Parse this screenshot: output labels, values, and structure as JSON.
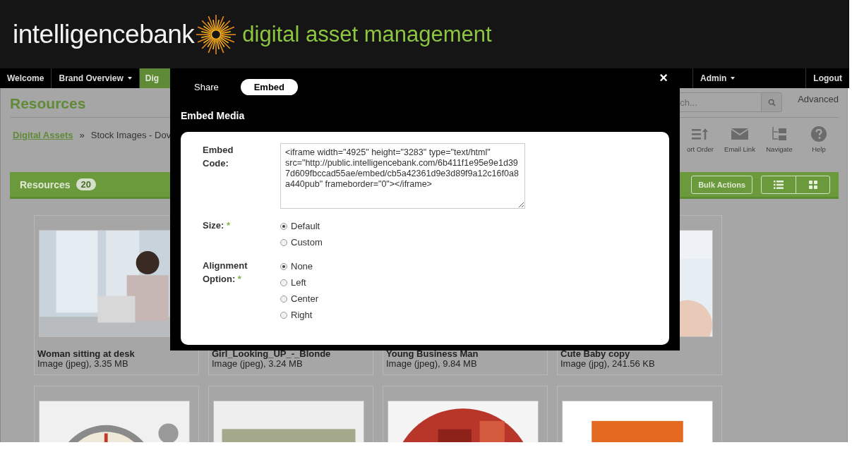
{
  "header": {
    "logo_text": "intelligencebank",
    "tagline": "digital asset management"
  },
  "nav": {
    "left": [
      {
        "label": "Welcome",
        "dropdown": false,
        "selected": false
      },
      {
        "label": "Brand Overview",
        "dropdown": true,
        "selected": false
      },
      {
        "label": "Dig",
        "dropdown": false,
        "selected": true
      }
    ],
    "right": [
      {
        "label": "Admin",
        "dropdown": true,
        "selected": false
      },
      {
        "label": "Logout",
        "dropdown": false,
        "selected": false
      }
    ]
  },
  "page": {
    "title": "Resources",
    "search": {
      "placeholder": "ch..."
    },
    "advanced": "Advanced",
    "breadcrumb": [
      {
        "label": "Digital Assets",
        "kind": "link"
      },
      {
        "label": "Stock Images - Dov",
        "kind": "current"
      }
    ],
    "breadcrumb_separator": "»",
    "toolbar": [
      {
        "label": "ort Order",
        "kind": "sort"
      },
      {
        "label": "Email Link",
        "kind": "email"
      },
      {
        "label": "Navigate",
        "kind": "navigate"
      },
      {
        "label": "Help",
        "kind": "help"
      }
    ],
    "bar": {
      "label": "Resources",
      "count": "20",
      "bulk_button": "Bulk Actions",
      "views": [
        {
          "kind": "list"
        },
        {
          "kind": "grid"
        }
      ]
    },
    "cards": [
      {
        "kind": "picture",
        "title": "Woman sitting at desk",
        "meta": "Image (jpeg), 3.35 MB"
      },
      {
        "kind": "covered",
        "title": "Girl_Looking_UP_-_Blonde",
        "meta": "Image (jpeg), 3.24 MB"
      },
      {
        "kind": "covered",
        "title": "Young Business Man",
        "meta": "Image (jpeg), 9.84 MB"
      },
      {
        "kind": "picture",
        "title": "Cute Baby copy",
        "meta": "Image (jpg), 241.56 KB"
      },
      {
        "kind": "picture"
      },
      {
        "kind": "picture"
      },
      {
        "kind": "picture"
      },
      {
        "kind": "picture"
      }
    ]
  },
  "modal": {
    "tabs": [
      {
        "label": "Share",
        "selected": false
      },
      {
        "label": "Embed",
        "selected": true
      }
    ],
    "close": "×",
    "title": "Embed Media",
    "embed_code": {
      "label": "Embed Code:",
      "value": "<iframe width=\"4925\" height=\"3283\" type=\"text/html\" src=\"http://public.intelligencebank.com/6b411f1e95e9e1d397d609fbccad55ae/embed/cb5a42361d9e3d89f9a12c16f0a8a440pub\" frameborder=\"0\"></iframe>"
    },
    "groups": [
      {
        "label": "Size:",
        "required_mark": "*",
        "options": [
          {
            "label": "Default",
            "selected": true
          },
          {
            "label": "Custom",
            "selected": false
          }
        ]
      },
      {
        "label": "Alignment Option:",
        "required_mark": "*",
        "options": [
          {
            "label": "None",
            "selected": true
          },
          {
            "label": "Left",
            "selected": false
          },
          {
            "label": "Center",
            "selected": false
          },
          {
            "label": "Right",
            "selected": false
          }
        ]
      }
    ]
  }
}
